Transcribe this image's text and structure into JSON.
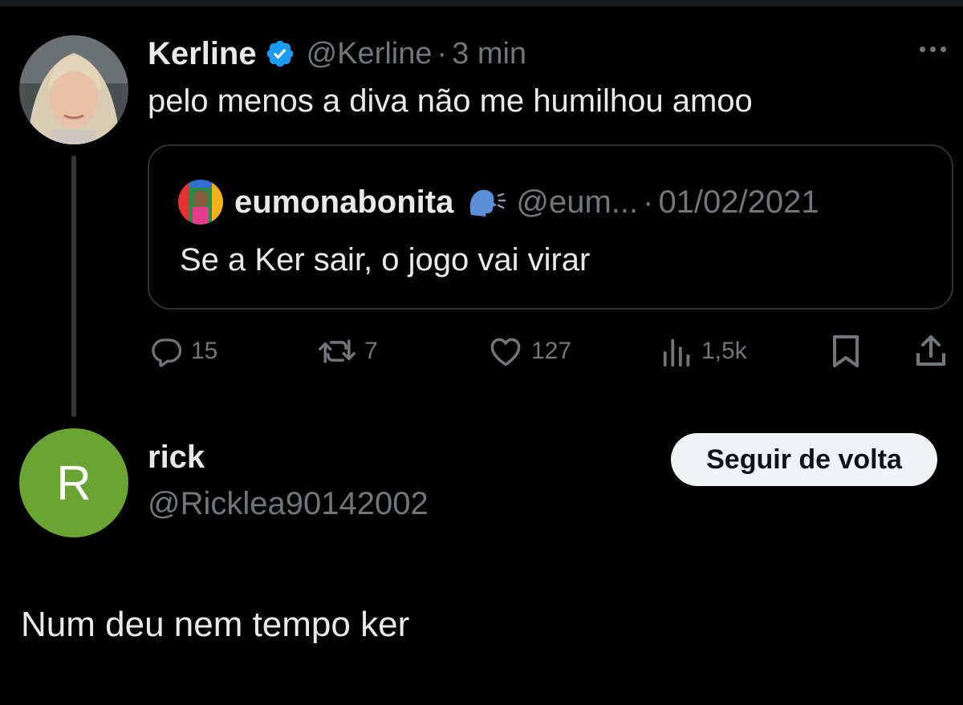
{
  "tweet": {
    "author": {
      "display_name": "Kerline",
      "handle": "@Kerline",
      "verified": true,
      "avatar": "profile-photo-blonde-woman"
    },
    "separator": "·",
    "time": "3 min",
    "text": "pelo menos a diva não me humilhou amoo",
    "quote": {
      "display_name": "eumonabonita",
      "name_emoji": "🗣",
      "handle": "@eum...",
      "separator": "·",
      "date": "01/02/2021",
      "text": "Se a Ker sair, o jogo vai virar"
    },
    "actions": {
      "replies": "15",
      "retweets": "7",
      "likes": "127",
      "views": "1,5k"
    }
  },
  "reply_user": {
    "display_name": "rick",
    "handle": "@Ricklea90142002",
    "avatar_initial": "R",
    "avatar_color": "#6aa533",
    "follow_button_label": "Seguir de volta"
  },
  "reply_text": "Num deu nem tempo ker",
  "colors": {
    "background": "#000000",
    "text_primary": "#e7e9ea",
    "text_secondary": "#71767b",
    "verified_blue": "#1d9bf0",
    "border": "#2f3336"
  }
}
